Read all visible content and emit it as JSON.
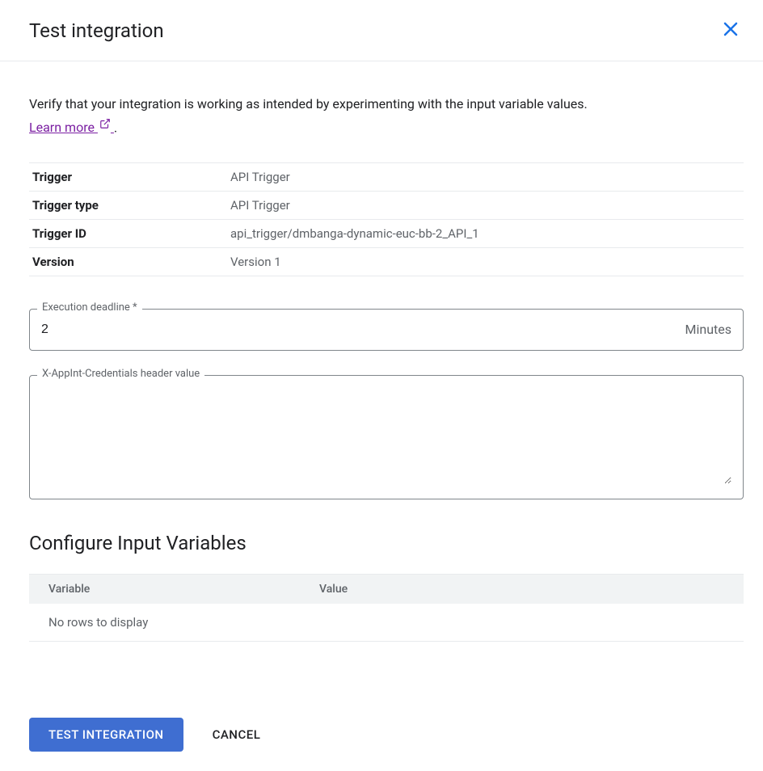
{
  "header": {
    "title": "Test integration"
  },
  "intro": {
    "text_before": "Verify that your integration is working as intended by experimenting with the input variable values. ",
    "learn_more": "Learn more",
    "text_after": "."
  },
  "info": {
    "rows": [
      {
        "label": "Trigger",
        "value": "API Trigger"
      },
      {
        "label": "Trigger type",
        "value": "API Trigger"
      },
      {
        "label": "Trigger ID",
        "value": "api_trigger/dmbanga-dynamic-euc-bb-2_API_1"
      },
      {
        "label": "Version",
        "value": "Version 1"
      }
    ]
  },
  "fields": {
    "execution_deadline": {
      "label": "Execution deadline *",
      "value": "2",
      "suffix": "Minutes"
    },
    "credentials_header": {
      "label": "X-AppInt-Credentials header value",
      "value": ""
    }
  },
  "vars_section": {
    "title": "Configure Input Variables",
    "col_variable": "Variable",
    "col_value": "Value",
    "empty_text": "No rows to display"
  },
  "footer": {
    "test_label": "TEST INTEGRATION",
    "cancel_label": "CANCEL"
  }
}
